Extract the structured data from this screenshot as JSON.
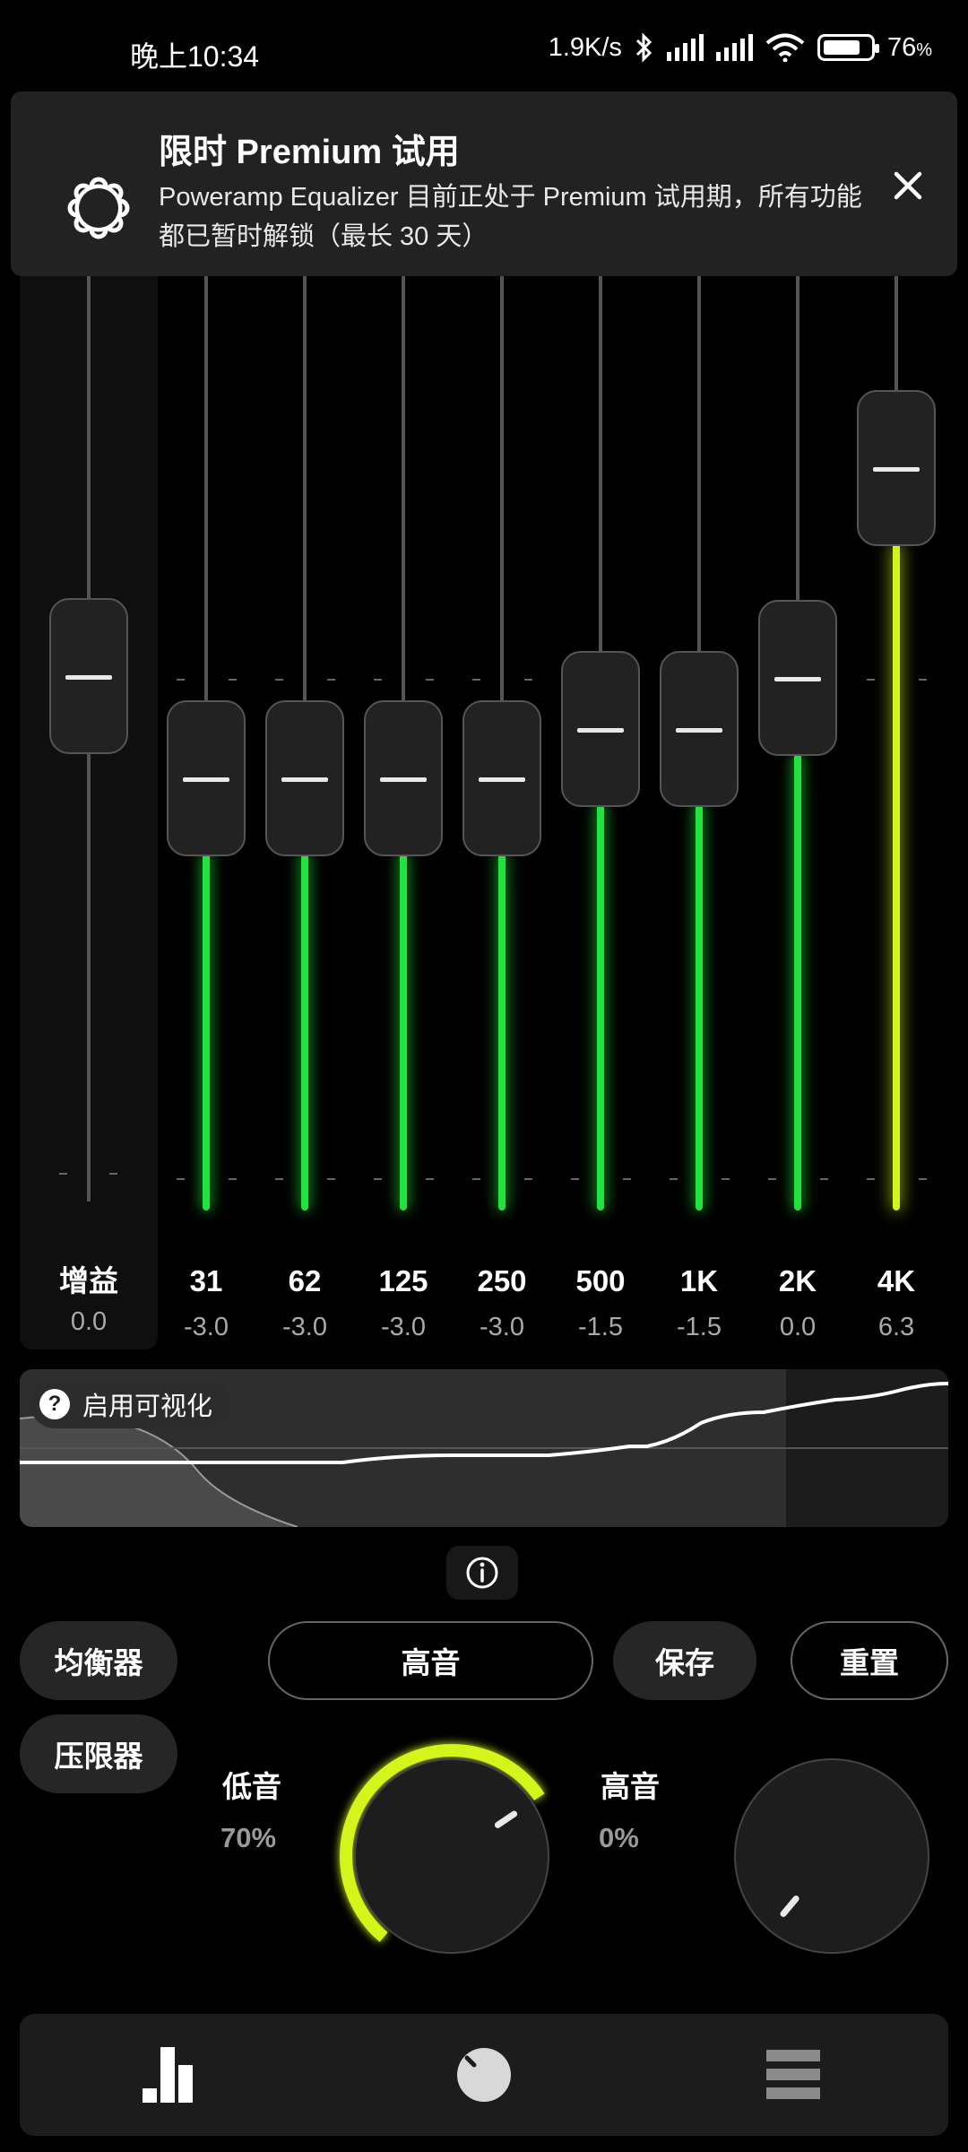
{
  "status_bar": {
    "time": "晚上10:34",
    "net_speed": "1.9K/s",
    "battery": "76",
    "battery_unit": "%",
    "battery_level": 0.76
  },
  "banner": {
    "title": "限时 Premium 试用",
    "message": "Poweramp Equalizer 目前正处于 Premium 试用期，所有功能都已暂时解锁（最长 30 天）"
  },
  "gain": {
    "label": "增益",
    "value": "0.0"
  },
  "bands": [
    {
      "freq": "31",
      "value": "-3.0"
    },
    {
      "freq": "62",
      "value": "-3.0"
    },
    {
      "freq": "125",
      "value": "-3.0"
    },
    {
      "freq": "250",
      "value": "-3.0"
    },
    {
      "freq": "500",
      "value": "-1.5"
    },
    {
      "freq": "1K",
      "value": "-1.5"
    },
    {
      "freq": "2K",
      "value": "0.0"
    },
    {
      "freq": "4K",
      "value": "6.3"
    }
  ],
  "visualizer": {
    "toggle_label": "启用可视化"
  },
  "buttons": {
    "equalizer": "均衡器",
    "limiter": "压限器",
    "preset": "高音",
    "save": "保存",
    "reset": "重置"
  },
  "bass": {
    "label": "低音",
    "value": "70%",
    "level": 0.7
  },
  "treble": {
    "label": "高音",
    "value": "0%",
    "level": 0
  },
  "colors": {
    "green": "#22e33d",
    "yellow": "#d4f51a",
    "panel": "#1c1c1c"
  }
}
